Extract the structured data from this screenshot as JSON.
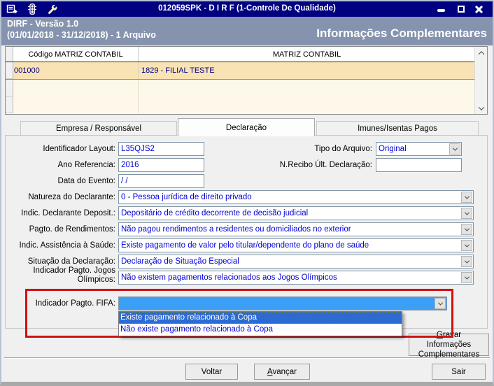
{
  "window": {
    "title": "012059SPK - D I R F (1-Controle De Qualidade)",
    "header": {
      "line1": "DIRF - Versão 1.0",
      "line2": "(01/01/2018 - 31/12/2018) - 1 Arquivo",
      "right_title": "Informações Complementares"
    }
  },
  "icons": {
    "titlebar": [
      "form-icon",
      "traffic-light-icon",
      "wrench-icon"
    ],
    "window_controls": [
      "minimize-icon",
      "maximize-icon",
      "close-icon"
    ],
    "combo_button": "chevron-down-icon",
    "scrollbar": [
      "chevron-up-icon",
      "chevron-down-icon"
    ]
  },
  "grid": {
    "columns": [
      "Código MATRIZ CONTABIL",
      "MATRIZ CONTABIL"
    ],
    "rows": [
      {
        "codigo": "001000",
        "matriz": "1829 - FILIAL TESTE",
        "selected": true
      }
    ]
  },
  "tabs": [
    {
      "label": "Empresa / Responsável",
      "active": false
    },
    {
      "label": "Declaração",
      "active": true
    },
    {
      "label": "Imunes/Isentas Pagos",
      "active": false
    }
  ],
  "form": {
    "identificador_layout": {
      "label": "Identificador Layout:",
      "value": "L35QJS2"
    },
    "tipo_arquivo": {
      "label": "Tipo do Arquivo:",
      "value": "Original"
    },
    "ano_referencia": {
      "label": "Ano Referencia:",
      "value": "2016"
    },
    "n_recibo_ult_declaracao": {
      "label": "N.Recibo Últ. Declaração:",
      "value": ""
    },
    "data_evento": {
      "label": "Data do Evento:",
      "value": "/ /"
    },
    "natureza_declarante": {
      "label": "Natureza do Declarante:",
      "value": "0 - Pessoa jurídica de direito privado"
    },
    "indic_declarante_deposit": {
      "label": "Indic. Declarante Deposit.:",
      "value": "Depositário de crédito decorrente de decisão judicial"
    },
    "pagto_rendimentos": {
      "label": "Pagto. de Rendimentos:",
      "value": "Não pagou rendimentos a residentes ou domiciliados no exterior"
    },
    "indic_assistencia_saude": {
      "label": "Indic. Assistência à Saúde:",
      "value": "Existe pagamento de valor pelo titular/dependente do plano de saúde"
    },
    "situacao_declaracao": {
      "label": "Situação da Declaração:",
      "value": "Declaração de Situação Especial"
    },
    "indicador_pagto_jogos": {
      "label": "Indicador Pagto. Jogos Olímpicos:",
      "value": "Não existem pagamentos relacionados aos Jogos Olímpicos"
    },
    "indicador_pagto_fifa": {
      "label": "Indicador Pagto. FIFA:",
      "value": "",
      "options": [
        "Existe pagamento relacionado à Copa",
        "Não existe pagamento relacionado à Copa"
      ],
      "highlighted_option_index": 0
    }
  },
  "buttons": {
    "gravar_line1": "Gravar Informações",
    "gravar_line2": "Complementares",
    "voltar": "Voltar",
    "avancar": "Avançar",
    "sair": "Sair"
  },
  "colors": {
    "titlebar": "#010081",
    "header_band": "#8593ae",
    "combo_open_fill": "#3b9ff5",
    "list_selection": "#2c6bd2",
    "annotation_red": "#d01111",
    "value_text_blue": "#0000dd",
    "grid_selected_row": "#f9e3b5",
    "grid_row_cream": "#fdf8e9",
    "grid_text_navy": "#000080"
  }
}
